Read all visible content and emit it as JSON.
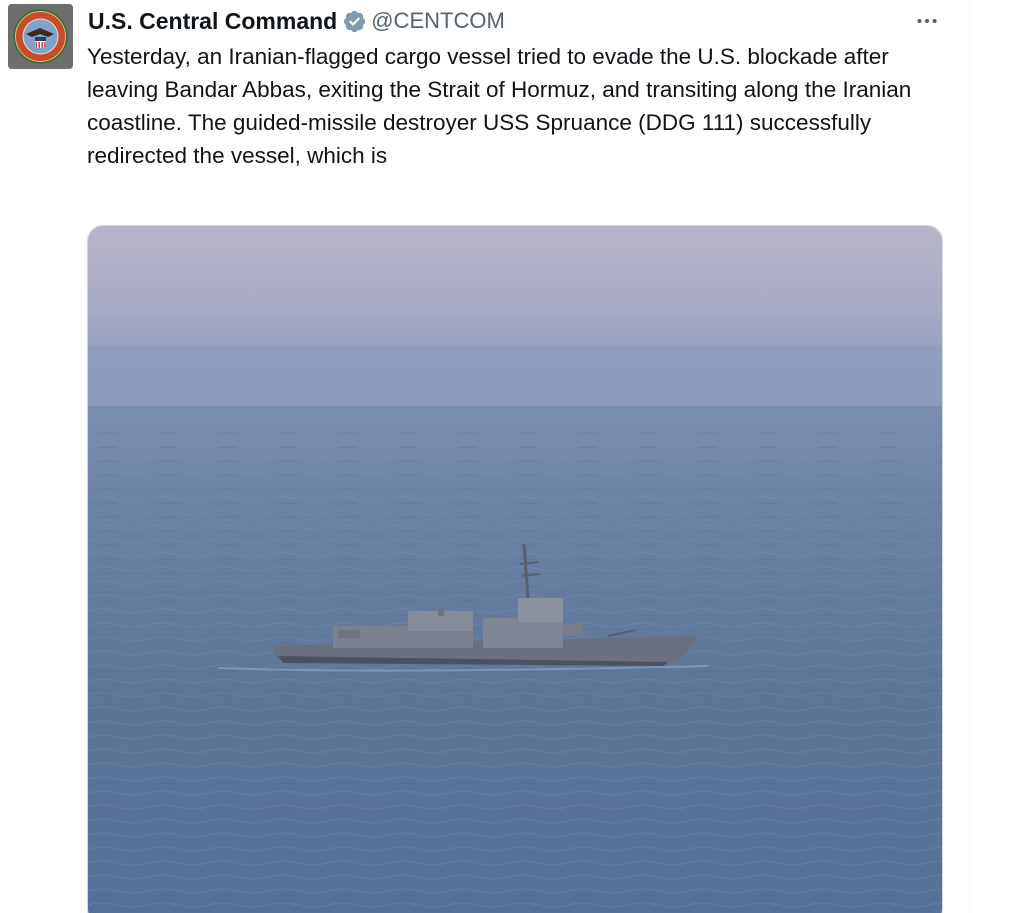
{
  "tweet": {
    "author": {
      "display_name": "U.S. Central Command",
      "handle": "@CENTCOM",
      "verified_icon": "verified-badge-icon",
      "avatar_icon": "centcom-seal-icon"
    },
    "more_icon": "more-options-icon",
    "text": "Yesterday, an Iranian-flagged cargo vessel tried to evade the U.S. blockade after leaving Bandar Abbas, exiting the Strait of Hormuz, and transiting along the Iranian coastline. The guided-missile destroyer USS Spruance (DDG 111) successfully redirected the vessel, which is",
    "media": {
      "kind": "photo",
      "scene": "destroyer-at-sea"
    }
  },
  "colors": {
    "text_primary": "#0f1419",
    "text_secondary": "#536471",
    "verified_badge": "#829aab",
    "border": "#cfd9de",
    "sea": "#5f7899",
    "sky": "#b9b6c9"
  }
}
